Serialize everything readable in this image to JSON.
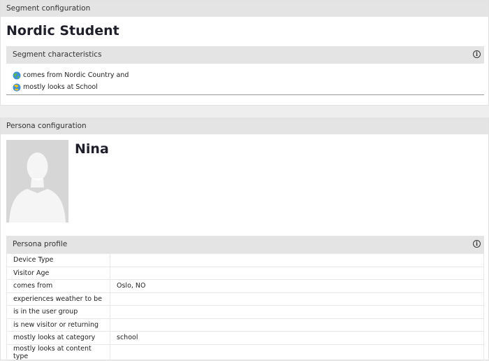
{
  "segment": {
    "header": "Segment configuration",
    "title": "Nordic Student",
    "characteristics_header": "Segment characteristics",
    "characteristics": [
      {
        "icon": "globe-icon",
        "text": "comes from Nordic Country and"
      },
      {
        "icon": "globe-icon",
        "text": "mostly looks at School"
      }
    ]
  },
  "persona": {
    "header": "Persona configuration",
    "name": "Nina",
    "profile_header": "Persona profile",
    "profile": [
      {
        "key": "Device Type",
        "value": ""
      },
      {
        "key": "Visitor Age",
        "value": ""
      },
      {
        "key": "comes from",
        "value": "Oslo, NO"
      },
      {
        "key": "experiences weather to be",
        "value": ""
      },
      {
        "key": "is in the user group",
        "value": ""
      },
      {
        "key": "is new visitor or returning",
        "value": ""
      },
      {
        "key": "mostly looks at category",
        "value": "school"
      },
      {
        "key": "mostly looks at content type",
        "value": ""
      }
    ]
  },
  "icons": {
    "info": "i"
  }
}
